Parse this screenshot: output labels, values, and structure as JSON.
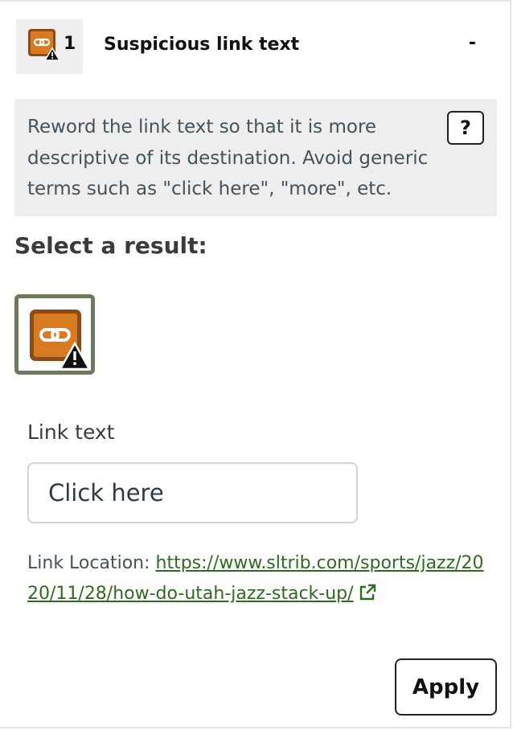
{
  "issue": {
    "count": "1",
    "title": "Suspicious link text",
    "collapse_label": "-",
    "icon": "suspicious-link-icon"
  },
  "description": {
    "text": "Reword the link text so that it is more descriptive of its destination. Avoid generic terms such as \"click here\", \"more\", etc.",
    "help_label": "?"
  },
  "results": {
    "heading": "Select a result:",
    "option_icon": "suspicious-link-icon"
  },
  "form": {
    "link_text_label": "Link text",
    "link_text_value": "Click here",
    "location_label": "Link Location: ",
    "location_url": "https://www.sltrib.com/sports/jazz/2020/11/28/how-do-utah-jazz-stack-up/",
    "apply_label": "Apply"
  },
  "colors": {
    "icon_orange": "#d87a1f",
    "icon_frame": "#8f4a16",
    "link_green": "#2e6b1f",
    "selected_border": "#6b7a5a",
    "panel_gray": "#eeeeee"
  }
}
